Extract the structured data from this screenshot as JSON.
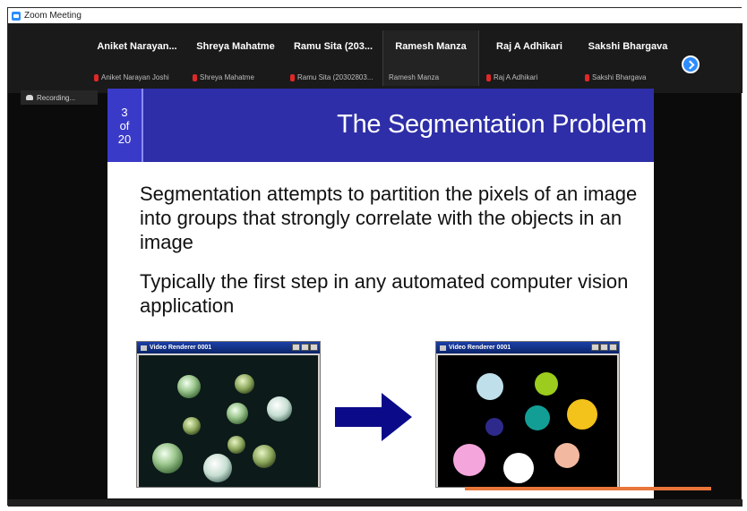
{
  "window": {
    "title": "Zoom Meeting"
  },
  "participants": [
    {
      "name": "Aniket Narayan...",
      "sub": "Aniket Narayan Joshi",
      "muted": true
    },
    {
      "name": "Shreya Mahatme",
      "sub": "Shreya Mahatme",
      "muted": true
    },
    {
      "name": "Ramu Sita (203...",
      "sub": "Ramu Sita (20302803...",
      "muted": true
    },
    {
      "name": "Ramesh Manza",
      "sub": "Ramesh Manza",
      "muted": false,
      "active": true
    },
    {
      "name": "Raj A Adhikari",
      "sub": "Raj A Adhikari",
      "muted": true
    },
    {
      "name": "Sakshi Bhargava",
      "sub": "Sakshi Bhargava",
      "muted": true
    }
  ],
  "next_button_icon": "chevron-right-icon",
  "recording": {
    "label": "Recording..."
  },
  "slide": {
    "number": "3",
    "of": "of",
    "total": "20",
    "title": "The Segmentation Problem",
    "bullets": [
      "Segmentation attempts to partition the pixels of an image into groups that strongly correlate with the objects in an image",
      "Typically the first step in any automated computer vision application"
    ],
    "images": [
      {
        "title": "Video Renderer 0001",
        "content": "coins"
      },
      {
        "title": "Video Renderer 0001",
        "content": "segmented"
      }
    ]
  },
  "colors": {
    "slide_header": "#2e2ea8",
    "zoom_blue": "#2d8cff",
    "arrow": "#0b0b8a",
    "segments": [
      "#bfe0ea",
      "#9ccc1e",
      "#2e2a8c",
      "#139e95",
      "#f3c21b",
      "#f4a6dc",
      "#ffffff",
      "#f2b8a0"
    ]
  }
}
